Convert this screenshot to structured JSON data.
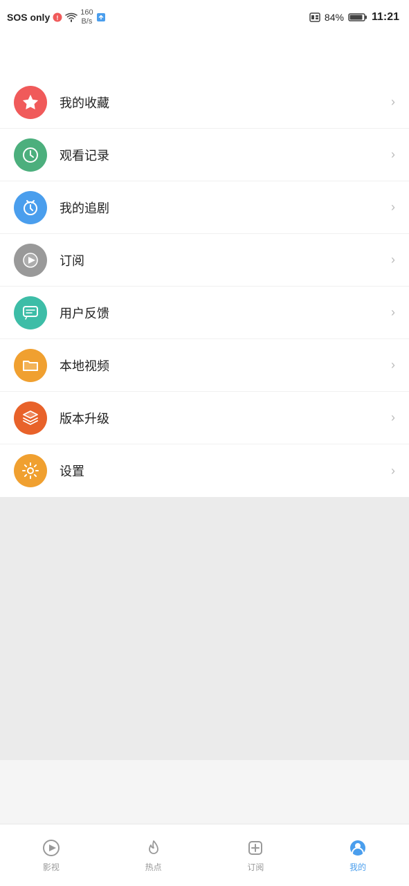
{
  "statusBar": {
    "sosText": "SOS only",
    "networkSpeed": "160\nB/s",
    "batteryPercent": "84%",
    "time": "11:21"
  },
  "menuItems": [
    {
      "id": "favorites",
      "label": "我的收藏",
      "iconColor": "icon-red",
      "iconType": "star"
    },
    {
      "id": "history",
      "label": "观看记录",
      "iconColor": "icon-green",
      "iconType": "clock"
    },
    {
      "id": "follow",
      "label": "我的追剧",
      "iconColor": "icon-blue",
      "iconType": "alarm"
    },
    {
      "id": "subscribe",
      "label": "订阅",
      "iconColor": "icon-gray",
      "iconType": "play"
    },
    {
      "id": "feedback",
      "label": "用户反馈",
      "iconColor": "icon-teal",
      "iconType": "chat"
    },
    {
      "id": "local",
      "label": "本地视频",
      "iconColor": "icon-orange",
      "iconType": "folder"
    },
    {
      "id": "update",
      "label": "版本升级",
      "iconColor": "icon-orange2",
      "iconType": "layers"
    },
    {
      "id": "settings",
      "label": "设置",
      "iconColor": "icon-yellow",
      "iconType": "gear"
    }
  ],
  "bottomNav": [
    {
      "id": "movies",
      "label": "影视",
      "active": false
    },
    {
      "id": "hot",
      "label": "热点",
      "active": false
    },
    {
      "id": "subscribe",
      "label": "订阅",
      "active": false
    },
    {
      "id": "mine",
      "label": "我的",
      "active": true
    }
  ]
}
